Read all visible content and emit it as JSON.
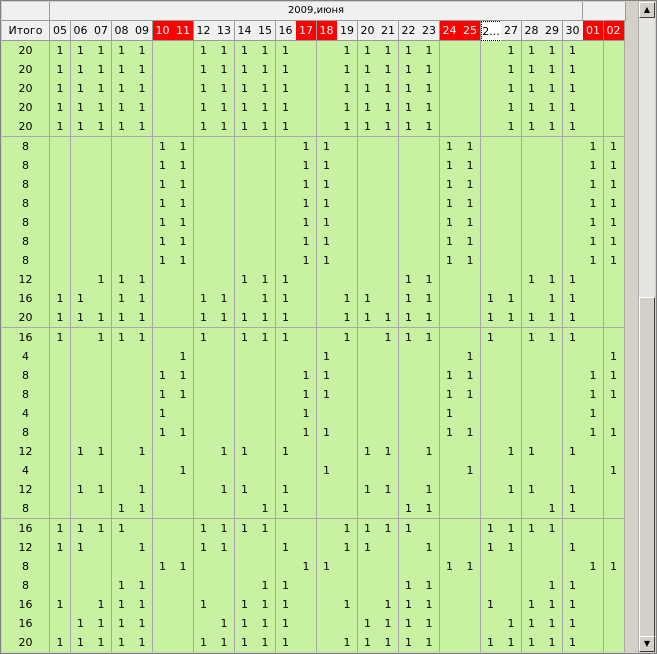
{
  "header": {
    "month_label": "2009,июня",
    "total_label": "Итого",
    "days": [
      {
        "label": "05",
        "red": false
      },
      {
        "label": "06",
        "red": false
      },
      {
        "label": "07",
        "red": false
      },
      {
        "label": "08",
        "red": false
      },
      {
        "label": "09",
        "red": false
      },
      {
        "label": "10",
        "red": true
      },
      {
        "label": "11",
        "red": true
      },
      {
        "label": "12",
        "red": false
      },
      {
        "label": "13",
        "red": false
      },
      {
        "label": "14",
        "red": false
      },
      {
        "label": "15",
        "red": false
      },
      {
        "label": "16",
        "red": false
      },
      {
        "label": "17",
        "red": true
      },
      {
        "label": "18",
        "red": true
      },
      {
        "label": "19",
        "red": false
      },
      {
        "label": "20",
        "red": false
      },
      {
        "label": "21",
        "red": false
      },
      {
        "label": "22",
        "red": false
      },
      {
        "label": "23",
        "red": false
      },
      {
        "label": "24",
        "red": true
      },
      {
        "label": "25",
        "red": true
      },
      {
        "label": "2...",
        "red": false,
        "selected": true
      },
      {
        "label": "27",
        "red": false
      },
      {
        "label": "28",
        "red": false
      },
      {
        "label": "29",
        "red": false
      },
      {
        "label": "30",
        "red": false
      },
      {
        "label": "01",
        "red": true
      },
      {
        "label": "02",
        "red": true
      }
    ]
  },
  "rows": [
    {
      "total": "20",
      "marks": [
        0,
        1,
        2,
        3,
        4,
        7,
        8,
        9,
        10,
        11,
        14,
        15,
        16,
        17,
        18,
        22,
        23,
        24,
        25
      ]
    },
    {
      "total": "20",
      "marks": [
        0,
        1,
        2,
        3,
        4,
        7,
        8,
        9,
        10,
        11,
        14,
        15,
        16,
        17,
        18,
        22,
        23,
        24,
        25
      ]
    },
    {
      "total": "20",
      "marks": [
        0,
        1,
        2,
        3,
        4,
        7,
        8,
        9,
        10,
        11,
        14,
        15,
        16,
        17,
        18,
        22,
        23,
        24,
        25
      ]
    },
    {
      "total": "20",
      "marks": [
        0,
        1,
        2,
        3,
        4,
        7,
        8,
        9,
        10,
        11,
        14,
        15,
        16,
        17,
        18,
        22,
        23,
        24,
        25
      ]
    },
    {
      "total": "20",
      "marks": [
        0,
        1,
        2,
        3,
        4,
        7,
        8,
        9,
        10,
        11,
        14,
        15,
        16,
        17,
        18,
        22,
        23,
        24,
        25
      ]
    },
    {
      "total": "8",
      "marks": [
        5,
        6,
        12,
        13,
        19,
        20,
        26,
        27
      ]
    },
    {
      "total": "8",
      "marks": [
        5,
        6,
        12,
        13,
        19,
        20,
        26,
        27
      ]
    },
    {
      "total": "8",
      "marks": [
        5,
        6,
        12,
        13,
        19,
        20,
        26,
        27
      ]
    },
    {
      "total": "8",
      "marks": [
        5,
        6,
        12,
        13,
        19,
        20,
        26,
        27
      ]
    },
    {
      "total": "8",
      "marks": [
        5,
        6,
        12,
        13,
        19,
        20,
        26,
        27
      ]
    },
    {
      "total": "8",
      "marks": [
        5,
        6,
        12,
        13,
        19,
        20,
        26,
        27
      ]
    },
    {
      "total": "8",
      "marks": [
        5,
        6,
        12,
        13,
        19,
        20,
        26,
        27
      ]
    },
    {
      "total": "12",
      "marks": [
        2,
        3,
        4,
        9,
        10,
        11,
        17,
        18,
        23,
        24,
        25
      ]
    },
    {
      "total": "16",
      "marks": [
        0,
        1,
        3,
        4,
        7,
        8,
        10,
        11,
        14,
        15,
        17,
        18,
        21,
        22,
        24,
        25
      ]
    },
    {
      "total": "20",
      "marks": [
        0,
        1,
        2,
        3,
        4,
        7,
        8,
        9,
        10,
        11,
        14,
        15,
        16,
        17,
        18,
        21,
        22,
        23,
        24,
        25
      ]
    },
    {
      "total": "16",
      "marks": [
        0,
        2,
        3,
        4,
        7,
        9,
        10,
        11,
        14,
        16,
        17,
        18,
        21,
        23,
        24,
        25
      ]
    },
    {
      "total": "4",
      "marks": [
        6,
        13,
        20,
        27
      ]
    },
    {
      "total": "8",
      "marks": [
        5,
        6,
        12,
        13,
        19,
        20,
        26,
        27
      ]
    },
    {
      "total": "8",
      "marks": [
        5,
        6,
        12,
        13,
        19,
        20,
        26,
        27
      ]
    },
    {
      "total": "4",
      "marks": [
        5,
        12,
        19,
        26
      ]
    },
    {
      "total": "8",
      "marks": [
        5,
        6,
        12,
        13,
        19,
        20,
        26,
        27
      ]
    },
    {
      "total": "12",
      "marks": [
        1,
        2,
        4,
        8,
        9,
        11,
        15,
        16,
        18,
        22,
        23,
        25
      ]
    },
    {
      "total": "4",
      "marks": [
        6,
        13,
        20,
        27
      ]
    },
    {
      "total": "12",
      "marks": [
        1,
        2,
        4,
        8,
        9,
        11,
        15,
        16,
        18,
        22,
        23,
        25
      ]
    },
    {
      "total": "8",
      "marks": [
        3,
        4,
        10,
        11,
        17,
        18,
        24,
        25
      ]
    },
    {
      "total": "16",
      "marks": [
        0,
        1,
        2,
        3,
        7,
        8,
        9,
        10,
        14,
        15,
        16,
        17,
        21,
        22,
        23,
        24
      ]
    },
    {
      "total": "12",
      "marks": [
        0,
        1,
        4,
        7,
        8,
        11,
        14,
        15,
        18,
        21,
        22,
        25
      ]
    },
    {
      "total": "8",
      "marks": [
        5,
        6,
        12,
        13,
        19,
        20,
        26,
        27
      ]
    },
    {
      "total": "8",
      "marks": [
        3,
        4,
        10,
        11,
        17,
        18,
        24,
        25
      ]
    },
    {
      "total": "16",
      "marks": [
        0,
        2,
        3,
        4,
        7,
        9,
        10,
        11,
        14,
        16,
        17,
        18,
        21,
        23,
        24,
        25
      ]
    },
    {
      "total": "16",
      "marks": [
        1,
        2,
        3,
        4,
        8,
        9,
        10,
        11,
        15,
        16,
        17,
        18,
        22,
        23,
        24,
        25
      ]
    },
    {
      "total": "20",
      "marks": [
        0,
        1,
        2,
        3,
        4,
        7,
        8,
        9,
        10,
        11,
        14,
        15,
        16,
        17,
        18,
        21,
        22,
        23,
        24,
        25
      ]
    }
  ],
  "mark_value": "1",
  "scrollbar": {
    "up_glyph": "▲",
    "down_glyph": "▼"
  },
  "colors": {
    "weekend": "#ff0000",
    "cell_bg": "#c8f2a2",
    "header_bg": "#f0f0f0"
  }
}
